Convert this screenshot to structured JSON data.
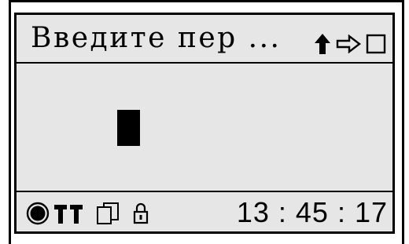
{
  "title_bar": {
    "prompt": "Введите пер ...",
    "icons": [
      "caps-arrow-icon",
      "right-arrow-icon",
      "square-icon"
    ]
  },
  "input": {
    "value": ""
  },
  "status_bar": {
    "icons": [
      "record-dot-icon",
      "signal-bars-icon",
      "copy-icon",
      "lock-icon"
    ],
    "time": "13 : 45 : 17"
  },
  "colors": {
    "screen_bg": "#e6e6e6",
    "ink": "#000000"
  }
}
